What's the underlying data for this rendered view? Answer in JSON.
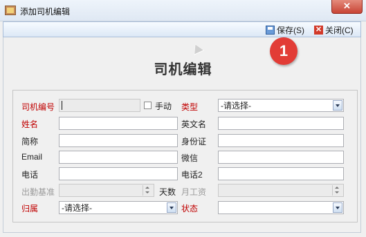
{
  "window": {
    "title": "添加司机编辑",
    "close_glyph": "✕"
  },
  "toolbar": {
    "save_label": "保存(S)",
    "close_label": "关闭(C)",
    "save_icon": "floppy-disk-icon",
    "close_icon": "close-red-x-icon"
  },
  "heading": "司机编辑",
  "badge": "1",
  "form": {
    "driver_no": {
      "label": "司机编号",
      "value": ""
    },
    "manual": {
      "label": "手动",
      "checked": false
    },
    "type": {
      "label": "类型",
      "value": "-请选择-"
    },
    "name": {
      "label": "姓名",
      "value": ""
    },
    "english_name": {
      "label": "英文名",
      "value": ""
    },
    "short_name": {
      "label": "简称",
      "value": ""
    },
    "id_card": {
      "label": "身份证",
      "value": ""
    },
    "email": {
      "label": "Email",
      "value": ""
    },
    "wechat": {
      "label": "微信",
      "value": ""
    },
    "phone": {
      "label": "电话",
      "value": ""
    },
    "phone2": {
      "label": "电话2",
      "value": ""
    },
    "attendance_base": {
      "label": "出勤基准",
      "value": "",
      "unit": "天数"
    },
    "monthly_salary": {
      "label": "月工资",
      "value": ""
    },
    "belong": {
      "label": "归属",
      "value": "-请选择-"
    },
    "status": {
      "label": "状态",
      "value": ""
    }
  },
  "colors": {
    "required_label": "#c00000",
    "disabled_label": "#9a9a9a",
    "badge": "#e23c36"
  }
}
